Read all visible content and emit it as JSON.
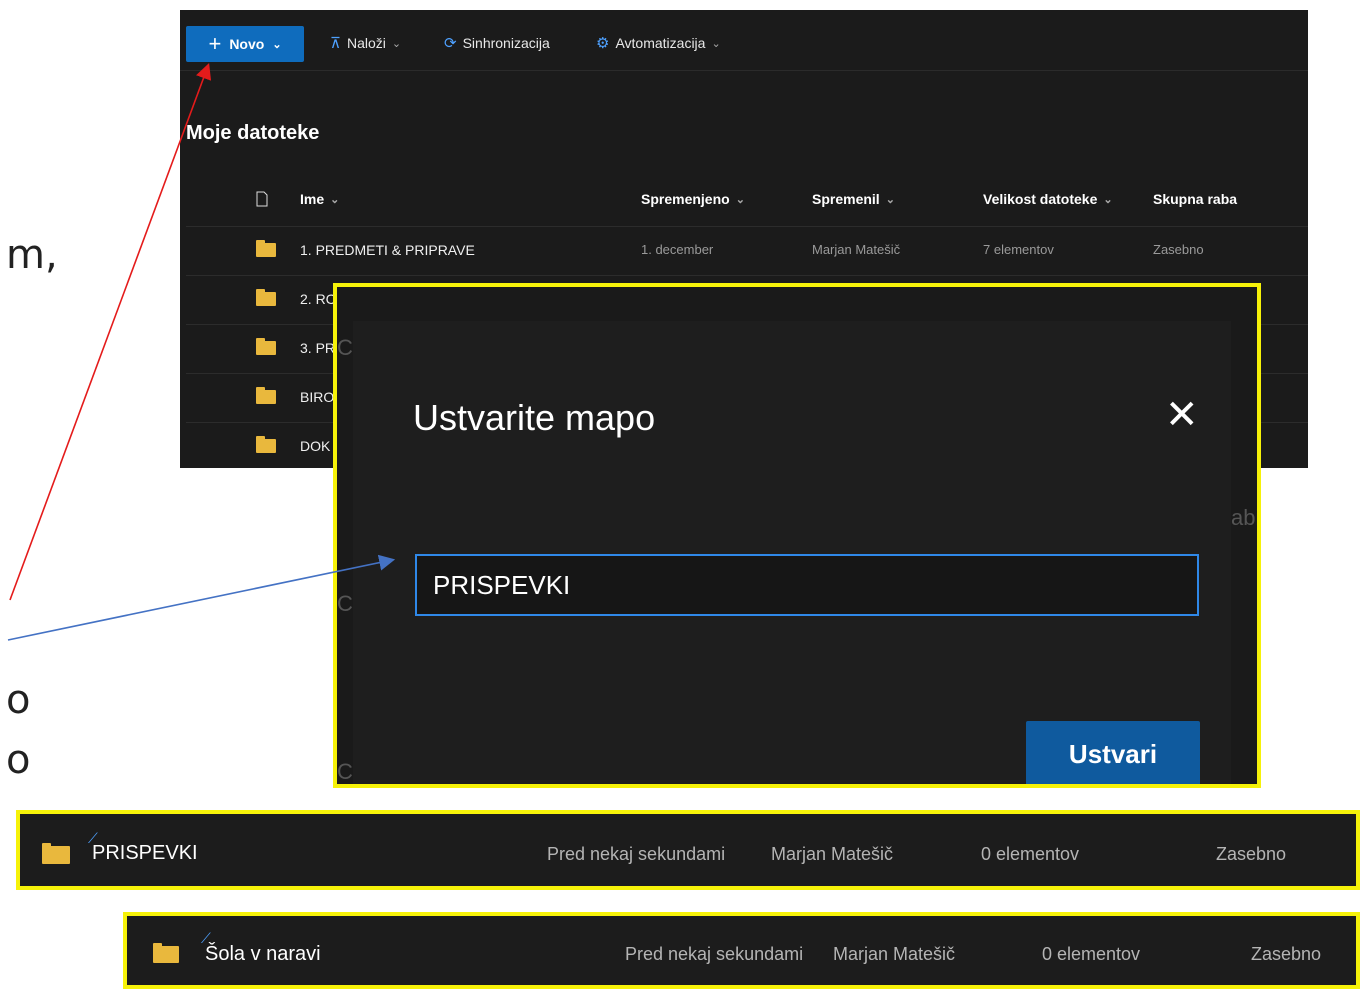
{
  "background_fragments": [
    "m,",
    "o",
    "o"
  ],
  "toolbar": {
    "new_label": "Novo",
    "upload_label": "Naloži",
    "sync_label": "Sinhronizacija",
    "automate_label": "Avtomatizacija"
  },
  "page_title": "Moje datoteke",
  "columns": {
    "name": "Ime",
    "modified": "Spremenjeno",
    "modified_by": "Spremenil",
    "size": "Velikost datoteke",
    "sharing": "Skupna raba"
  },
  "rows": [
    {
      "name": "1. PREDMETI & PRIPRAVE",
      "modified": "1. december",
      "modified_by": "Marjan Matešič",
      "size": "7 elementov",
      "sharing": "Zasebno"
    },
    {
      "name": "2. RC"
    },
    {
      "name": "3. PR"
    },
    {
      "name": "BIRO"
    },
    {
      "name": "DOK"
    }
  ],
  "dialog": {
    "title": "Ustvarite mapo",
    "input_value": "PRISPEVKI",
    "create_label": "Ustvari",
    "edge_fragments": [
      "C",
      "abi",
      "C",
      "C"
    ]
  },
  "results": [
    {
      "name": "PRISPEVKI",
      "modified": "Pred nekaj sekundami",
      "modified_by": "Marjan Matešič",
      "size": "0 elementov",
      "sharing": "Zasebno"
    },
    {
      "name": "Šola v naravi",
      "modified": "Pred nekaj sekundami",
      "modified_by": "Marjan Matešič",
      "size": "0 elementov",
      "sharing": "Zasebno"
    }
  ],
  "colors": {
    "highlight": "#f6f209",
    "accent": "#0f6cbd",
    "arrow_red": "#e41b1b",
    "arrow_blue": "#4472c4",
    "folder": "#e9b83d"
  }
}
